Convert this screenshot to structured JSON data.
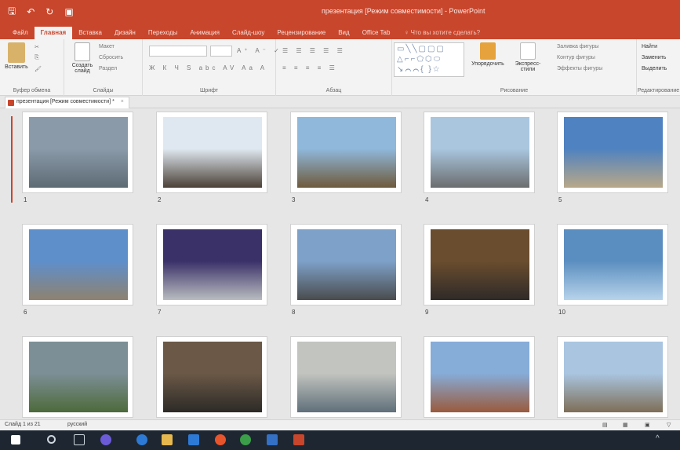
{
  "window": {
    "title": "презентация [Режим совместимости] - PowerPoint",
    "qat_save": "🖫",
    "qat_undo": "↶",
    "qat_redo": "↻",
    "qat_slideshow": "▣"
  },
  "ribbon_tabs": [
    {
      "label": "Файл"
    },
    {
      "label": "Главная"
    },
    {
      "label": "Вставка"
    },
    {
      "label": "Дизайн"
    },
    {
      "label": "Переходы"
    },
    {
      "label": "Анимация"
    },
    {
      "label": "Слайд-шоу"
    },
    {
      "label": "Рецензирование"
    },
    {
      "label": "Вид"
    },
    {
      "label": "Office Tab"
    }
  ],
  "tell_me": "♀ Что вы хотите сделать?",
  "ribbon": {
    "clipboard": {
      "paste": "Вставить",
      "label": "Буфер обмена"
    },
    "slides": {
      "create": "Создать слайд",
      "layout": "Макет",
      "reset": "Сбросить",
      "section": "Раздел",
      "label": "Слайды"
    },
    "font": {
      "label": "Шрифт",
      "row1": "A⁺ A⁻ ✓",
      "row2": "Ж К Ч S abc AV Aa A"
    },
    "paragraph": {
      "label": "Абзац",
      "row1": "☰ ☰ ☰ ☰ ☰",
      "row2": "≡ ≡ ≡ ≡ ☰"
    },
    "drawing": {
      "label": "Рисование",
      "arrange": "Упорядочить",
      "quick_styles": "Экспресс-стили",
      "fill": "Заливка фигуры",
      "outline": "Контур фигуры",
      "effects": "Эффекты фигуры",
      "shapes": "▭╲╲▢▢▢ △⌐⌐⬠⬡⬭ ↘⌒⌒{ }☆"
    },
    "editing": {
      "label": "Редактирование",
      "find": "Найти",
      "replace": "Заменить",
      "select": "Выделить"
    }
  },
  "document_tab": {
    "label": "презентация [Режим совместимости] *",
    "close": "×"
  },
  "slides": [
    {
      "num": "1",
      "colors": [
        "#8a9aa8",
        "#5d6b74"
      ]
    },
    {
      "num": "2",
      "colors": [
        "#dfe8f0",
        "#4a4036"
      ]
    },
    {
      "num": "3",
      "colors": [
        "#8fb8da",
        "#6e5a3c"
      ]
    },
    {
      "num": "4",
      "colors": [
        "#a9c6de",
        "#6b6d6e"
      ]
    },
    {
      "num": "5",
      "colors": [
        "#4f82c0",
        "#b9a888"
      ]
    },
    {
      "num": "6",
      "colors": [
        "#5e8fcb",
        "#8e826f"
      ]
    },
    {
      "num": "7",
      "colors": [
        "#3a3168",
        "#b9bcc0"
      ]
    },
    {
      "num": "8",
      "colors": [
        "#7ea1c9",
        "#4a4c4d"
      ]
    },
    {
      "num": "9",
      "colors": [
        "#6a4d2e",
        "#2f2a28"
      ]
    },
    {
      "num": "10",
      "colors": [
        "#5b8ec0",
        "#b7d3ea"
      ]
    },
    {
      "num": "",
      "colors": [
        "#7c8f96",
        "#4d6a3a"
      ]
    },
    {
      "num": "",
      "colors": [
        "#6b5847",
        "#2c2a26"
      ]
    },
    {
      "num": "",
      "colors": [
        "#c2c4bf",
        "#5f6f7a"
      ]
    },
    {
      "num": "",
      "colors": [
        "#86acd8",
        "#9a5a3c"
      ]
    },
    {
      "num": "",
      "colors": [
        "#a9c5e0",
        "#7e6e56"
      ]
    }
  ],
  "status": {
    "slide_info": "Слайд 1 из 21",
    "language": "русский"
  },
  "accent": "#c8462c"
}
